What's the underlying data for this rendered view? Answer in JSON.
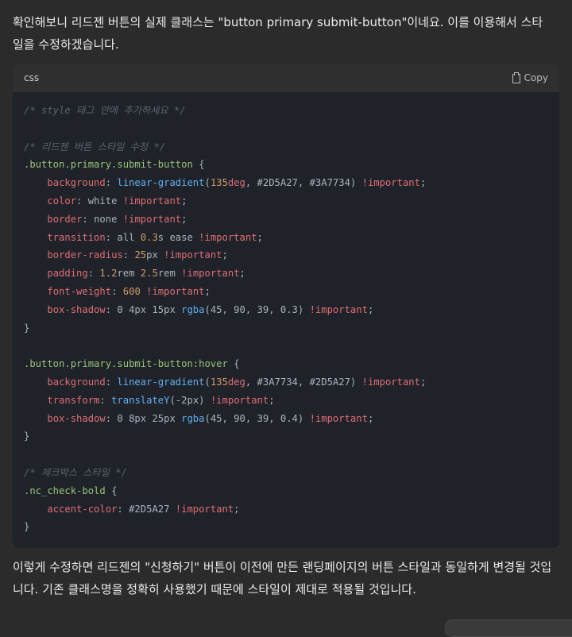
{
  "message": {
    "intro": "확인해보니 리드젠 버튼의 실제 클래스는 \"button primary submit-button\"이네요. 이를 이용해서 스타일을 수정하겠습니다.",
    "outro": "이렇게 수정하면 리드젠의 \"신청하기\" 버튼이 이전에 만든 랜딩페이지의 버튼 스타일과 동일하게 변경될 것입니다. 기존 클래스명을 정확히 사용했기 때문에 스타일이 제대로 적용될 것입니다."
  },
  "code_block": {
    "language": "css",
    "copy_label": "Copy",
    "copy_icon": "clipboard-icon",
    "lines": [
      [
        [
          "cm",
          "/* style 태그 안에 추가하세요 */"
        ]
      ],
      [],
      [
        [
          "cm",
          "/* 리드젠 버튼 스타일 수정 */"
        ]
      ],
      [
        [
          "sel",
          ".button.primary.submit-button"
        ],
        [
          "pl",
          " {"
        ]
      ],
      [
        [
          "pl",
          "    "
        ],
        [
          "pr",
          "background"
        ],
        [
          "pl",
          ": "
        ],
        [
          "fn",
          "linear-gradient"
        ],
        [
          "pl",
          "("
        ],
        [
          "num",
          "135"
        ],
        [
          "pr",
          "deg"
        ],
        [
          "pl",
          ", #2D5A27, #3A7734) "
        ],
        [
          "imp",
          "!important"
        ],
        [
          "pl",
          ";"
        ]
      ],
      [
        [
          "pl",
          "    "
        ],
        [
          "pr",
          "color"
        ],
        [
          "pl",
          ": white "
        ],
        [
          "imp",
          "!important"
        ],
        [
          "pl",
          ";"
        ]
      ],
      [
        [
          "pl",
          "    "
        ],
        [
          "pr",
          "border"
        ],
        [
          "pl",
          ": none "
        ],
        [
          "imp",
          "!important"
        ],
        [
          "pl",
          ";"
        ]
      ],
      [
        [
          "pl",
          "    "
        ],
        [
          "pr",
          "transition"
        ],
        [
          "pl",
          ": all "
        ],
        [
          "num",
          "0.3"
        ],
        [
          "pl",
          "s ease "
        ],
        [
          "imp",
          "!important"
        ],
        [
          "pl",
          ";"
        ]
      ],
      [
        [
          "pl",
          "    "
        ],
        [
          "pr",
          "border-radius"
        ],
        [
          "pl",
          ": "
        ],
        [
          "num",
          "25"
        ],
        [
          "pl",
          "px "
        ],
        [
          "imp",
          "!important"
        ],
        [
          "pl",
          ";"
        ]
      ],
      [
        [
          "pl",
          "    "
        ],
        [
          "pr",
          "padding"
        ],
        [
          "pl",
          ": "
        ],
        [
          "num",
          "1.2"
        ],
        [
          "pl",
          "rem "
        ],
        [
          "num",
          "2.5"
        ],
        [
          "pl",
          "rem "
        ],
        [
          "imp",
          "!important"
        ],
        [
          "pl",
          ";"
        ]
      ],
      [
        [
          "pl",
          "    "
        ],
        [
          "pr",
          "font-weight"
        ],
        [
          "pl",
          ": "
        ],
        [
          "num",
          "600"
        ],
        [
          "pl",
          " "
        ],
        [
          "imp",
          "!important"
        ],
        [
          "pl",
          ";"
        ]
      ],
      [
        [
          "pl",
          "    "
        ],
        [
          "pr",
          "box-shadow"
        ],
        [
          "pl",
          ": 0 4px 15px "
        ],
        [
          "fn",
          "rgba"
        ],
        [
          "pl",
          "(45, 90, 39, 0.3) "
        ],
        [
          "imp",
          "!important"
        ],
        [
          "pl",
          ";"
        ]
      ],
      [
        [
          "pl",
          "}"
        ]
      ],
      [],
      [
        [
          "sel",
          ".button.primary.submit-button:hover"
        ],
        [
          "pl",
          " {"
        ]
      ],
      [
        [
          "pl",
          "    "
        ],
        [
          "pr",
          "background"
        ],
        [
          "pl",
          ": "
        ],
        [
          "fn",
          "linear-gradient"
        ],
        [
          "pl",
          "("
        ],
        [
          "num",
          "135"
        ],
        [
          "pr",
          "deg"
        ],
        [
          "pl",
          ", #3A7734, #2D5A27) "
        ],
        [
          "imp",
          "!important"
        ],
        [
          "pl",
          ";"
        ]
      ],
      [
        [
          "pl",
          "    "
        ],
        [
          "pr",
          "transform"
        ],
        [
          "pl",
          ": "
        ],
        [
          "fn",
          "translateY"
        ],
        [
          "pl",
          "(-2px) "
        ],
        [
          "imp",
          "!important"
        ],
        [
          "pl",
          ";"
        ]
      ],
      [
        [
          "pl",
          "    "
        ],
        [
          "pr",
          "box-shadow"
        ],
        [
          "pl",
          ": 0 8px 25px "
        ],
        [
          "fn",
          "rgba"
        ],
        [
          "pl",
          "(45, 90, 39, 0.4) "
        ],
        [
          "imp",
          "!important"
        ],
        [
          "pl",
          ";"
        ]
      ],
      [
        [
          "pl",
          "}"
        ]
      ],
      [],
      [
        [
          "cm",
          "/* 체크박스 스타일 */"
        ]
      ],
      [
        [
          "sel",
          ".nc_check-bold"
        ],
        [
          "pl",
          " {"
        ]
      ],
      [
        [
          "pl",
          "    "
        ],
        [
          "pr",
          "accent-color"
        ],
        [
          "pl",
          ": #2D5A27 "
        ],
        [
          "imp",
          "!important"
        ],
        [
          "pl",
          ";"
        ]
      ],
      [
        [
          "pl",
          "}"
        ]
      ]
    ]
  }
}
